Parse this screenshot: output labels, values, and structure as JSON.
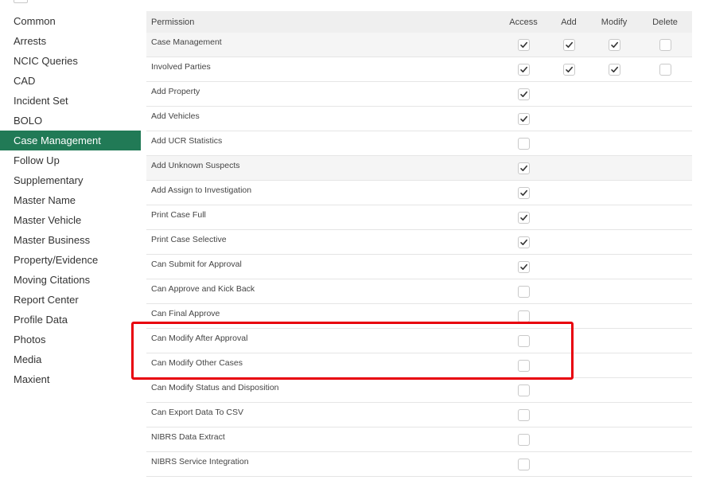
{
  "sidebar": {
    "items": [
      {
        "label": "Common",
        "active": false
      },
      {
        "label": "Arrests",
        "active": false
      },
      {
        "label": "NCIC Queries",
        "active": false
      },
      {
        "label": "CAD",
        "active": false
      },
      {
        "label": "Incident Set",
        "active": false
      },
      {
        "label": "BOLO",
        "active": false
      },
      {
        "label": "Case Management",
        "active": true
      },
      {
        "label": "Follow Up",
        "active": false
      },
      {
        "label": "Supplementary",
        "active": false
      },
      {
        "label": "Master Name",
        "active": false
      },
      {
        "label": "Master Vehicle",
        "active": false
      },
      {
        "label": "Master Business",
        "active": false
      },
      {
        "label": "Property/Evidence",
        "active": false
      },
      {
        "label": "Moving Citations",
        "active": false
      },
      {
        "label": "Report Center",
        "active": false
      },
      {
        "label": "Profile Data",
        "active": false
      },
      {
        "label": "Photos",
        "active": false
      },
      {
        "label": "Media",
        "active": false
      },
      {
        "label": "Maxient",
        "active": false
      }
    ]
  },
  "table": {
    "headers": {
      "permission": "Permission",
      "access": "Access",
      "add": "Add",
      "modify": "Modify",
      "delete": "Delete"
    },
    "rows": [
      {
        "label": "Case Management",
        "access": true,
        "add": true,
        "modify": true,
        "delete": false,
        "shaded": true
      },
      {
        "label": "Involved Parties",
        "access": true,
        "add": true,
        "modify": true,
        "delete": false,
        "shaded": false
      },
      {
        "label": "Add Property",
        "access": true,
        "shaded": false
      },
      {
        "label": "Add Vehicles",
        "access": true,
        "shaded": false
      },
      {
        "label": "Add UCR Statistics",
        "access": false,
        "shaded": false
      },
      {
        "label": "Add Unknown Suspects",
        "access": true,
        "shaded": true
      },
      {
        "label": "Add Assign to Investigation",
        "access": true,
        "shaded": false
      },
      {
        "label": "Print Case Full",
        "access": true,
        "shaded": false
      },
      {
        "label": "Print Case Selective",
        "access": true,
        "shaded": false
      },
      {
        "label": "Can Submit for Approval",
        "access": true,
        "shaded": false
      },
      {
        "label": "Can Approve and Kick Back",
        "access": false,
        "shaded": false
      },
      {
        "label": "Can Final Approve",
        "access": false,
        "shaded": false
      },
      {
        "label": "Can Modify After Approval",
        "access": false,
        "shaded": false
      },
      {
        "label": "Can Modify Other Cases",
        "access": false,
        "shaded": false
      },
      {
        "label": "Can Modify Status and Disposition",
        "access": false,
        "shaded": false
      },
      {
        "label": "Can Export Data To CSV",
        "access": false,
        "shaded": false
      },
      {
        "label": "NIBRS Data Extract",
        "access": false,
        "shaded": false
      },
      {
        "label": "NIBRS Service Integration",
        "access": false,
        "shaded": false
      }
    ]
  },
  "colors": {
    "accent": "#217a56",
    "highlight": "#e8000d"
  }
}
